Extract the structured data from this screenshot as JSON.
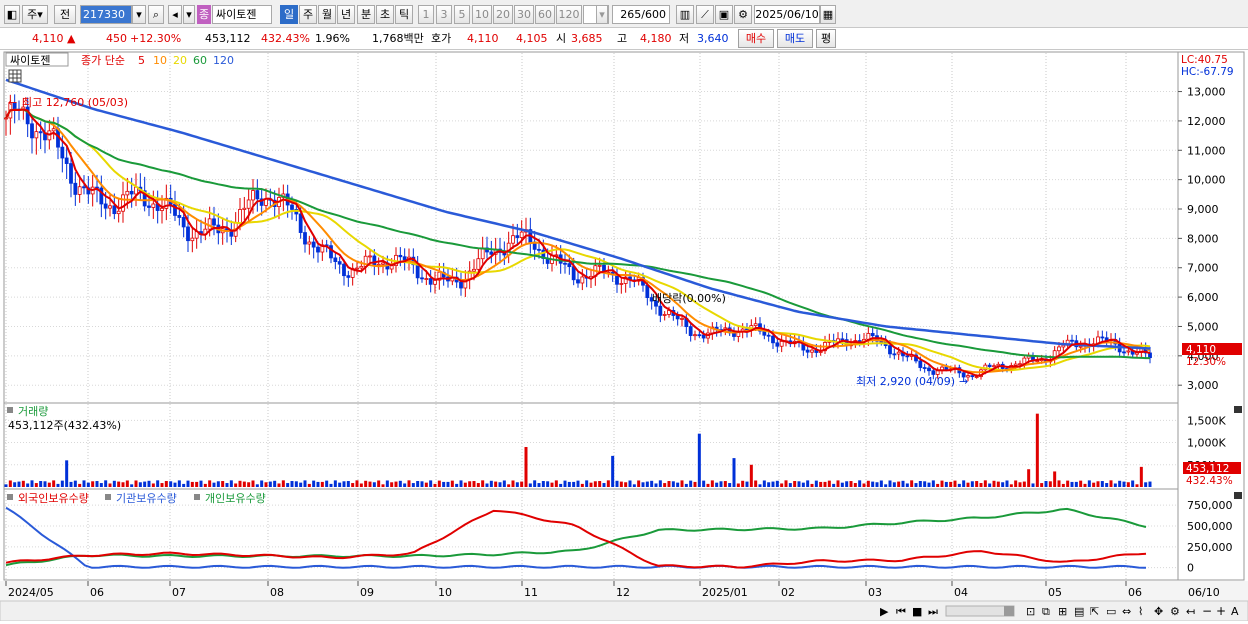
{
  "toolbar": {
    "type_label": "주",
    "prev_label": "전",
    "code_value": "217330",
    "stock_name": "싸이토젠",
    "period_buttons": [
      "일",
      "주",
      "월",
      "년",
      "분",
      "초",
      "틱"
    ],
    "interval_buttons": [
      "1",
      "3",
      "5",
      "10",
      "20",
      "30",
      "60",
      "120"
    ],
    "count_value": "265",
    "count_max": "/600",
    "date_value": "2025/06/10"
  },
  "quote": {
    "price": "4,110",
    "up_arrow": "▲",
    "change": "450",
    "change_pct": "+12.30%",
    "volume": "453,112",
    "volume_ratio": "432.43%",
    "turnover_pct": "1.96%",
    "amount": "1,768백만",
    "ask_label": "호가",
    "ask_value": "4,110",
    "bid_value": "4,105",
    "open_label": "시",
    "open_value": "3,685",
    "high_label": "고",
    "high_value": "4,180",
    "low_label": "저",
    "low_value": "3,640",
    "buy_label": "매수",
    "sell_label": "매도",
    "eval_label": "평"
  },
  "price_panel": {
    "name_label": "싸이토젠",
    "legend_prefix": "종가 단순",
    "ma_labels": [
      "5",
      "10",
      "20",
      "60",
      "120"
    ],
    "ma_colors": [
      "#e00000",
      "#ff8c00",
      "#e8d800",
      "#1a9a3a",
      "#2a5ad8"
    ],
    "lc_text": "LC:40.75",
    "hc_text": "HC:-67.79",
    "high_annotation": "최고 12,760 (05/03)",
    "low_annotation": "최저 2,920 (04/09)",
    "dividend_annotation": "배당락(0.00%)",
    "y_ticks": [
      "13,000",
      "12,000",
      "11,000",
      "10,000",
      "9,000",
      "8,000",
      "7,000",
      "6,000",
      "5,000",
      "4,000",
      "3,000"
    ],
    "current_price_tag": "4,110",
    "current_pct_tag": "12.30%"
  },
  "volume_panel": {
    "title": "거래량",
    "value_text": "453,112주(432.43%)",
    "y_ticks": [
      "1,500K",
      "1,000K",
      "500K"
    ],
    "current_tag": "453,112",
    "current_pct_tag": "432.43%"
  },
  "holding_panel": {
    "legend_items": [
      "외국인보유수량",
      "기관보유수량",
      "개인보유수량"
    ],
    "legend_colors": [
      "#e00000",
      "#2a5ad8",
      "#1a9a3a"
    ],
    "y_ticks": [
      "750,000",
      "500,000",
      "250,000",
      "0"
    ]
  },
  "x_axis": {
    "labels": [
      "2024/05",
      "06",
      "07",
      "08",
      "09",
      "10",
      "11",
      "12",
      "2025/01",
      "02",
      "03",
      "04",
      "05",
      "06"
    ],
    "right_label": "06/10"
  },
  "chart_data": {
    "type": "line",
    "x": [
      "2024/05",
      "06",
      "07",
      "08",
      "09",
      "10",
      "11",
      "12",
      "2025/01",
      "02",
      "03",
      "04",
      "05",
      "06"
    ],
    "series": [
      {
        "name": "종가",
        "values": [
          12100,
          9800,
          8400,
          9100,
          7000,
          6800,
          7800,
          6400,
          4800,
          4500,
          4300,
          3200,
          4400,
          4110
        ]
      },
      {
        "name": "120",
        "values": [
          13400,
          12400,
          11600,
          10700,
          9800,
          8900,
          8200,
          7300,
          6300,
          5500,
          5000,
          4700,
          4400,
          4250
        ]
      }
    ],
    "ylim": [
      2700,
      13700
    ]
  }
}
